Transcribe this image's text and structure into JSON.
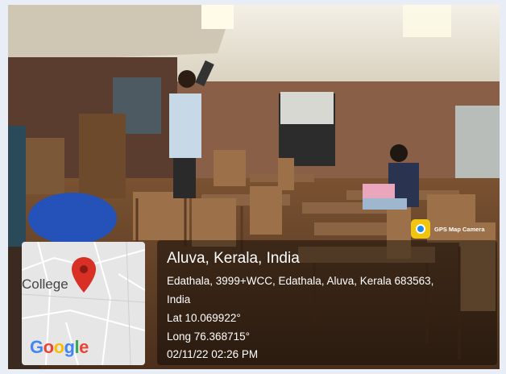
{
  "stamp": {
    "app_label": "GPS Map Camera",
    "app_icon": "gps-map-camera-icon",
    "title": "Aluva, Kerala, India",
    "address_line1": "Edathala, 3999+WCC, Edathala, Aluva, Kerala 683563,",
    "address_line2": "India",
    "lat": "Lat 10.069922°",
    "long": "Long 76.368715°",
    "datetime": "02/11/22 02:26 PM"
  },
  "map": {
    "place_label": "College",
    "brand": "Google",
    "pin_icon": "map-pin-icon",
    "pin_color": "#d93025"
  }
}
